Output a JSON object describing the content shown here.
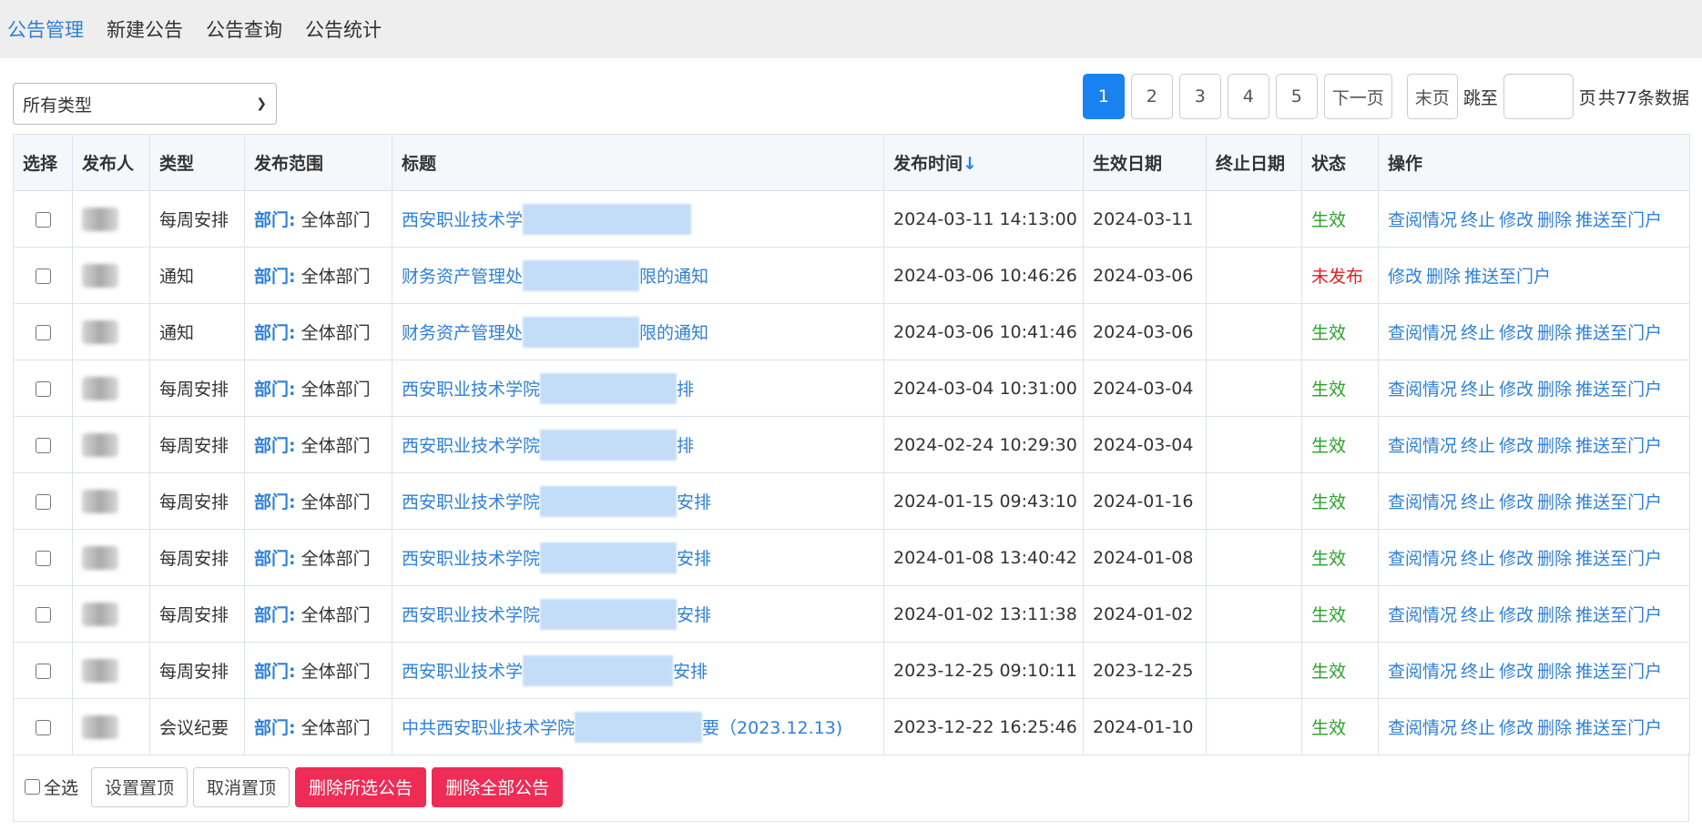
{
  "nav": {
    "items": [
      "公告管理",
      "新建公告",
      "公告查询",
      "公告统计"
    ]
  },
  "filter": {
    "type_select": "所有类型"
  },
  "pager": {
    "pages": [
      "1",
      "2",
      "3",
      "4",
      "5"
    ],
    "next": "下一页",
    "last": "末页",
    "jump": "跳至",
    "page_unit": "页",
    "total": "共77条数据"
  },
  "table": {
    "headers": [
      "选择",
      "发布人",
      "类型",
      "发布范围",
      "标题",
      "发布时间",
      "生效日期",
      "终止日期",
      "状态",
      "操作"
    ],
    "sort_arrow": "↓",
    "dept_label": "部门:",
    "rows": [
      {
        "type": "每周安排",
        "scope": "全体部门",
        "title_a": "西安职业技术学",
        "title_b": "",
        "time": "2024-03-11 14:13:00",
        "eff": "2024-03-11",
        "end": "",
        "status": "生效"
      },
      {
        "type": "通知",
        "scope": "全体部门",
        "title_a": "财务资产管理处",
        "title_b": "限的通知",
        "time": "2024-03-06 10:46:26",
        "eff": "2024-03-06",
        "end": "",
        "status": "未发布"
      },
      {
        "type": "通知",
        "scope": "全体部门",
        "title_a": "财务资产管理处",
        "title_b": "限的通知",
        "time": "2024-03-06 10:41:46",
        "eff": "2024-03-06",
        "end": "",
        "status": "生效"
      },
      {
        "type": "每周安排",
        "scope": "全体部门",
        "title_a": "西安职业技术学院",
        "title_b": "排",
        "time": "2024-03-04 10:31:00",
        "eff": "2024-03-04",
        "end": "",
        "status": "生效"
      },
      {
        "type": "每周安排",
        "scope": "全体部门",
        "title_a": "西安职业技术学院",
        "title_b": "排",
        "time": "2024-02-24 10:29:30",
        "eff": "2024-03-04",
        "end": "",
        "status": "生效"
      },
      {
        "type": "每周安排",
        "scope": "全体部门",
        "title_a": "西安职业技术学院",
        "title_b": "安排",
        "time": "2024-01-15 09:43:10",
        "eff": "2024-01-16",
        "end": "",
        "status": "生效"
      },
      {
        "type": "每周安排",
        "scope": "全体部门",
        "title_a": "西安职业技术学院",
        "title_b": "安排",
        "time": "2024-01-08 13:40:42",
        "eff": "2024-01-08",
        "end": "",
        "status": "生效"
      },
      {
        "type": "每周安排",
        "scope": "全体部门",
        "title_a": "西安职业技术学院",
        "title_b": "安排",
        "time": "2024-01-02 13:11:38",
        "eff": "2024-01-02",
        "end": "",
        "status": "生效"
      },
      {
        "type": "每周安排",
        "scope": "全体部门",
        "title_a": "西安职业技术学",
        "title_b": "安排",
        "time": "2023-12-25 09:10:11",
        "eff": "2023-12-25",
        "end": "",
        "status": "生效"
      },
      {
        "type": "会议纪要",
        "scope": "全体部门",
        "title_a": "中共西安职业技术学院",
        "title_b": "要（2023.12.13)",
        "time": "2023-12-22 16:25:46",
        "eff": "2024-01-10",
        "end": "",
        "status": "生效"
      }
    ],
    "ops_full": [
      "查阅情况",
      "终止",
      "修改",
      "删除",
      "推送至门户"
    ],
    "ops_unpublished": [
      "修改",
      "删除",
      "推送至门户"
    ]
  },
  "footer": {
    "select_all": "全选",
    "set_top": "设置置顶",
    "cancel_top": "取消置顶",
    "delete_selected": "删除所选公告",
    "delete_all": "删除全部公告"
  }
}
